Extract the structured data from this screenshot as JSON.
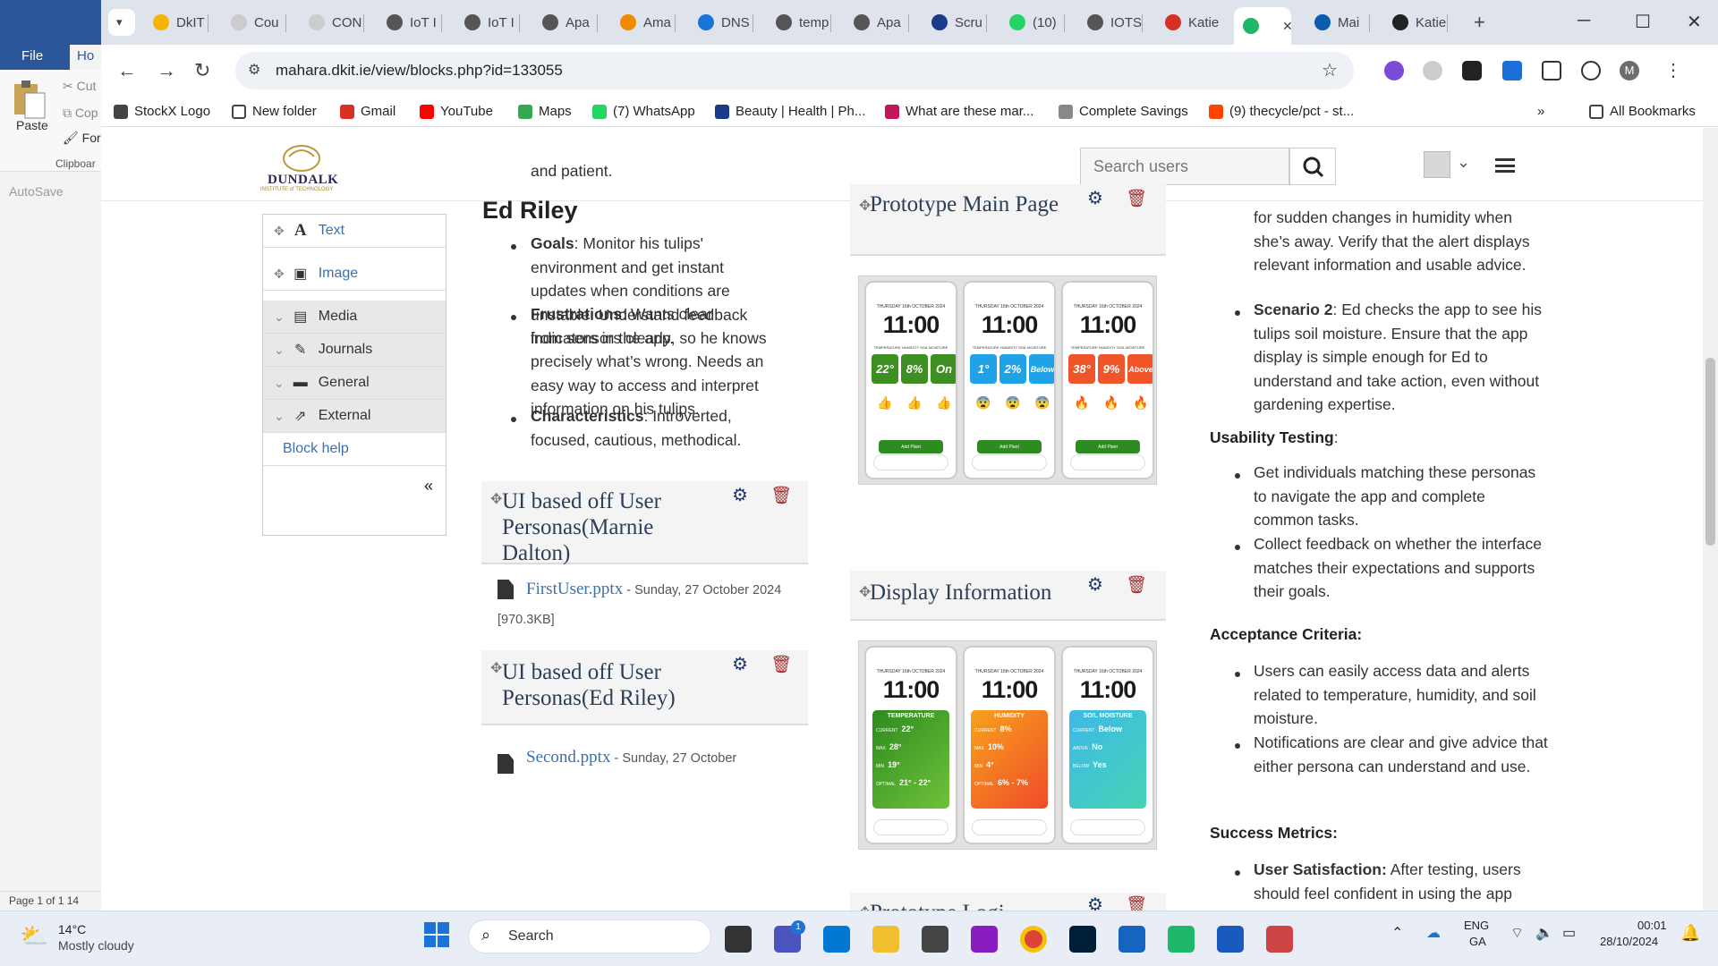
{
  "word": {
    "file_tab": "File",
    "home_tab": "Ho",
    "paste": "Paste",
    "cut": "Cut",
    "copy": "Cop",
    "format": "For",
    "clipboard": "Clipboar",
    "autosave": "AutoSave",
    "status": "Page 1 of 1",
    "status2": "14"
  },
  "tabs": [
    "DkIT",
    "Cou",
    "CON",
    "IoT I",
    "IoT I",
    "Apa",
    "Ama",
    "DNS",
    "temp",
    "Apa",
    "Scru",
    "(10)",
    "IOTS",
    "Katie",
    "",
    "Mai",
    "Katie"
  ],
  "browser": {
    "url": "mahara.dkit.ie/view/blocks.php?id=133055",
    "avatar_letter": "M"
  },
  "bookmarks": [
    "StockX Logo",
    "New folder",
    "Gmail",
    "YouTube",
    "Maps",
    "(7) WhatsApp",
    "Beauty | Health | Ph...",
    "What are these mar...",
    "Complete Savings",
    "(9) thecycle/pct - st...",
    "All Bookmarks"
  ],
  "site": {
    "logo_text": "DUNDALK",
    "logo_sub": "INSTITUTE of TECHNOLOGY",
    "search_placeholder": "Search users"
  },
  "block_panel": {
    "items": [
      "Text",
      "Image",
      "Media",
      "Journals",
      "General",
      "External"
    ],
    "help": "Block help",
    "collapse": "«"
  },
  "middle": {
    "top_fragment": "and patient.",
    "persona_name": "Ed Riley",
    "goals_label": "Goals",
    "goals_text": ": Monitor his tulips' environment and get instant updates when conditions are unstable. Understand feedback from sensors clearly.",
    "frustrations_label": "Frustrations",
    "frustrations_text": ": Wants clear indicators in the app, so he knows precisely what’s wrong. Needs an easy way to access and interpret information on his tulips.",
    "characteristics_label": "Characteristics",
    "characteristics_text": ": Introverted, focused, cautious, methodical.",
    "block1_title": "UI based off User Personas(Marnie Dalton)",
    "block1_file": "FirstUser.pptx",
    "block1_meta": " - Sunday, 27 October 2024 [970.3KB]",
    "block2_title": "UI based off User Personas(Ed Riley)",
    "block2_file": "Second.pptx",
    "block2_meta": " - Sunday, 27 October"
  },
  "images": {
    "block1_title": "Prototype Main Page",
    "block2_title": "Display Information",
    "block3_title": "Prototype Logi",
    "clock": "11:00",
    "date": "THURSDAY 16th OCTOBER 2024",
    "main_phones": [
      {
        "tiles": [
          "22°",
          "8%",
          "On"
        ],
        "color": "#3d8f22",
        "emoji": "👍",
        "button": "Add Plant"
      },
      {
        "tiles": [
          "1°",
          "2%",
          "Below"
        ],
        "color": "#1fa2e6",
        "emoji": "😨",
        "button": "Add Plant"
      },
      {
        "tiles": [
          "38°",
          "9%",
          "Above"
        ],
        "color": "#f0552a",
        "emoji": "🔥",
        "button": "Add Plant"
      }
    ],
    "tile_labels": "TEMPERATURE   HUMIDITY   SOIL MOISTURE",
    "info_phones": [
      {
        "title": "TEMPERATURE",
        "rows": [
          [
            "CURRENT",
            "22°"
          ],
          [
            "MAX",
            "28°"
          ],
          [
            "MIN",
            "19°"
          ],
          [
            "OPTIMAL",
            "21° - 22°"
          ]
        ]
      },
      {
        "title": "HUMIDITY",
        "rows": [
          [
            "CURRENT",
            "8%"
          ],
          [
            "MAX",
            "10%"
          ],
          [
            "MIN",
            "4°"
          ],
          [
            "OPTIMAL",
            "6% - 7%"
          ]
        ]
      },
      {
        "title": "SOIL MOISTURE",
        "rows": [
          [
            "CURRENT",
            "Below"
          ],
          [
            "ABOVE",
            "No"
          ],
          [
            "BELOW",
            "Yes"
          ]
        ]
      }
    ]
  },
  "right": {
    "l1": "for sudden changes in humidity when she’s away. Verify that the alert displays relevant information and usable advice.",
    "scenario2_label": "Scenario 2",
    "scenario2_text": ": Ed checks the app to see his tulips soil moisture. Ensure that the app display is simple enough for Ed to understand and take action, even without gardening expertise.",
    "usability_label": "Usability Testing",
    "usability_colon": ":",
    "u1": "Get individuals matching these personas to navigate the app and complete common tasks.",
    "u2": "Collect feedback on whether the interface matches their expectations and supports their goals.",
    "acceptance_label": "Acceptance Criteria:",
    "a1": "Users can easily access data and alerts related to temperature, humidity, and soil moisture.",
    "a2": "Notifications are clear and give advice that either persona can understand and use.",
    "success_label": "Success Metrics:",
    "s1_label": "User Satisfaction:",
    "s1_text": " After testing, users should feel confident in using the app"
  },
  "taskbar": {
    "temp": "14°C",
    "weather": "Mostly cloudy",
    "search": "Search",
    "lang1": "ENG",
    "lang2": "GA",
    "time": "00:01",
    "date": "28/10/2024",
    "teams_badge": "1"
  },
  "colors": {
    "accent": "#3a6fb0",
    "title": "#2c3f59",
    "gear": "#1c3a6e",
    "trash": "#a03030"
  }
}
